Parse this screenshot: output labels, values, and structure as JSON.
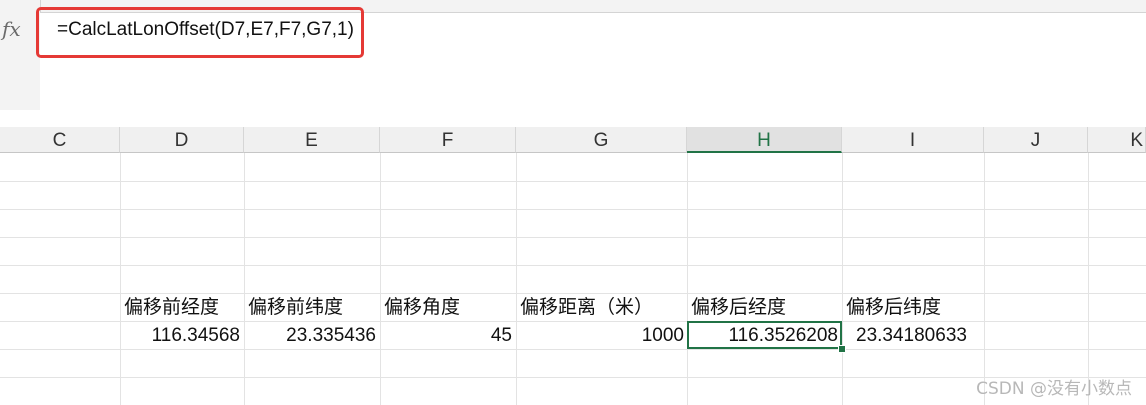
{
  "formula_bar": {
    "fx_label": "fx",
    "formula": "=CalcLatLonOffset(D7,E7,F7,G7,1)"
  },
  "columns": [
    "C",
    "D",
    "E",
    "F",
    "G",
    "H",
    "I",
    "J",
    "K"
  ],
  "headers_row": {
    "D": "偏移前经度",
    "E": "偏移前纬度",
    "F": "偏移角度",
    "G": "偏移距离（米）",
    "H": "偏移后经度",
    "I": "偏移后纬度"
  },
  "values_row": {
    "D": "116.34568",
    "E": "23.335436",
    "F": "45",
    "G": "1000",
    "H": "116.3526208",
    "I": "23.34180633"
  },
  "selected_cell": "H7",
  "colors": {
    "highlight": "#e53935",
    "selection": "#217346"
  },
  "watermark": "CSDN @没有小数点"
}
